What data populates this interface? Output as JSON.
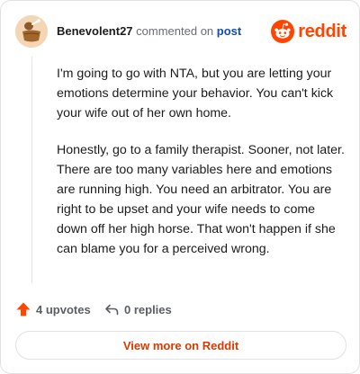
{
  "comment": {
    "author": "Benevolent27",
    "action_text": "commented on",
    "post_link_text": "post",
    "avatar_icon": "potter-avatar-icon",
    "body_paragraphs": [
      "I'm going to go with NTA, but you are letting your emotions determine your behavior. You can't kick your wife out of her own home.",
      "Honestly, go to a family therapist. Sooner, not later. There are too many variables here and emotions are running high. You need an arbitrator. You are right to be upset and your wife needs to come down off her high horse. That won't happen if she can blame you for a perceived wrong."
    ]
  },
  "brand": {
    "name": "reddit",
    "logo_icon": "reddit-snoo-icon",
    "color": "#ff4500"
  },
  "actions": {
    "upvotes_label": "4 upvotes",
    "upvote_icon": "upvote-arrow-icon",
    "replies_label": "0 replies",
    "reply_icon": "reply-arrow-icon"
  },
  "footer": {
    "view_more_label": "View more on Reddit",
    "accent_color": "#d93a00"
  }
}
